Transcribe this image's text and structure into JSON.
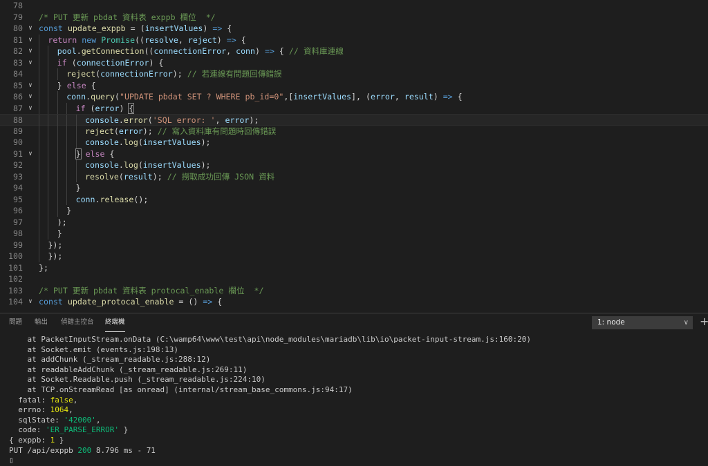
{
  "editor": {
    "lines": [
      {
        "n": "78",
        "fold": false,
        "indent": 0,
        "tokens": []
      },
      {
        "n": "79",
        "fold": false,
        "indent": 0,
        "tokens": [
          [
            "/* PUT 更新 pbdat 資料表 exppb 欄位  */",
            "com"
          ]
        ]
      },
      {
        "n": "80",
        "fold": true,
        "indent": 0,
        "tokens": [
          [
            "const",
            "kw"
          ],
          [
            " ",
            "pun"
          ],
          [
            "update_exppb",
            "fn"
          ],
          [
            " = (",
            "pun"
          ],
          [
            "insertValues",
            "var"
          ],
          [
            ") ",
            "pun"
          ],
          [
            "=>",
            "kw"
          ],
          [
            " {",
            "pun"
          ]
        ]
      },
      {
        "n": "81",
        "fold": true,
        "indent": 1,
        "tokens": [
          [
            "return",
            "ctl"
          ],
          [
            " ",
            "pun"
          ],
          [
            "new",
            "kw"
          ],
          [
            " ",
            "pun"
          ],
          [
            "Promise",
            "cls"
          ],
          [
            "((",
            "pun"
          ],
          [
            "resolve",
            "var"
          ],
          [
            ", ",
            "pun"
          ],
          [
            "reject",
            "var"
          ],
          [
            ") ",
            "pun"
          ],
          [
            "=>",
            "kw"
          ],
          [
            " {",
            "pun"
          ]
        ]
      },
      {
        "n": "82",
        "fold": true,
        "indent": 2,
        "tokens": [
          [
            "pool",
            "var"
          ],
          [
            ".",
            "pun"
          ],
          [
            "getConnection",
            "fn"
          ],
          [
            "((",
            "pun"
          ],
          [
            "connectionError",
            "var"
          ],
          [
            ", ",
            "pun"
          ],
          [
            "conn",
            "var"
          ],
          [
            ") ",
            "pun"
          ],
          [
            "=>",
            "kw"
          ],
          [
            " { ",
            "pun"
          ],
          [
            "// 資料庫連線",
            "com"
          ]
        ]
      },
      {
        "n": "83",
        "fold": true,
        "indent": 2,
        "tokens": [
          [
            "if",
            "ctl"
          ],
          [
            " (",
            "pun"
          ],
          [
            "connectionError",
            "var"
          ],
          [
            ") {",
            "pun"
          ]
        ]
      },
      {
        "n": "84",
        "fold": false,
        "indent": 3,
        "tokens": [
          [
            "reject",
            "fn"
          ],
          [
            "(",
            "pun"
          ],
          [
            "connectionError",
            "var"
          ],
          [
            "); ",
            "pun"
          ],
          [
            "// 若連線有問題回傳錯誤",
            "com"
          ]
        ]
      },
      {
        "n": "85",
        "fold": true,
        "indent": 2,
        "tokens": [
          [
            "} ",
            "pun"
          ],
          [
            "else",
            "ctl"
          ],
          [
            " {",
            "pun"
          ]
        ]
      },
      {
        "n": "86",
        "fold": true,
        "indent": 3,
        "tokens": [
          [
            "conn",
            "var"
          ],
          [
            ".",
            "pun"
          ],
          [
            "query",
            "fn"
          ],
          [
            "(",
            "pun"
          ],
          [
            "\"UPDATE pbdat SET ? WHERE pb_id=0\"",
            "str"
          ],
          [
            ",[",
            "pun"
          ],
          [
            "insertValues",
            "var"
          ],
          [
            "], (",
            "pun"
          ],
          [
            "error",
            "var"
          ],
          [
            ", ",
            "pun"
          ],
          [
            "result",
            "var"
          ],
          [
            ") ",
            "pun"
          ],
          [
            "=>",
            "kw"
          ],
          [
            " {",
            "pun"
          ]
        ]
      },
      {
        "n": "87",
        "fold": true,
        "indent": 4,
        "tokens": [
          [
            "if",
            "ctl"
          ],
          [
            " (",
            "pun"
          ],
          [
            "error",
            "var"
          ],
          [
            ") ",
            "pun"
          ],
          [
            "{",
            "box"
          ]
        ]
      },
      {
        "n": "88",
        "fold": false,
        "indent": 5,
        "current": true,
        "tokens": [
          [
            "console",
            "var"
          ],
          [
            ".",
            "pun"
          ],
          [
            "error",
            "fn"
          ],
          [
            "(",
            "pun"
          ],
          [
            "'SQL error: '",
            "str"
          ],
          [
            ", ",
            "pun"
          ],
          [
            "error",
            "var"
          ],
          [
            ");",
            "pun"
          ]
        ]
      },
      {
        "n": "89",
        "fold": false,
        "indent": 5,
        "tokens": [
          [
            "reject",
            "fn"
          ],
          [
            "(",
            "pun"
          ],
          [
            "error",
            "var"
          ],
          [
            "); ",
            "pun"
          ],
          [
            "// 寫入資料庫有問題時回傳錯誤",
            "com"
          ]
        ]
      },
      {
        "n": "90",
        "fold": false,
        "indent": 5,
        "tokens": [
          [
            "console",
            "var"
          ],
          [
            ".",
            "pun"
          ],
          [
            "log",
            "fn"
          ],
          [
            "(",
            "pun"
          ],
          [
            "insertValues",
            "var"
          ],
          [
            ");",
            "pun"
          ]
        ]
      },
      {
        "n": "91",
        "fold": true,
        "indent": 4,
        "tokens": [
          [
            "}",
            "box"
          ],
          [
            " ",
            "pun"
          ],
          [
            "else",
            "ctl"
          ],
          [
            " {",
            "pun"
          ]
        ]
      },
      {
        "n": "92",
        "fold": false,
        "indent": 5,
        "tokens": [
          [
            "console",
            "var"
          ],
          [
            ".",
            "pun"
          ],
          [
            "log",
            "fn"
          ],
          [
            "(",
            "pun"
          ],
          [
            "insertValues",
            "var"
          ],
          [
            ");",
            "pun"
          ]
        ]
      },
      {
        "n": "93",
        "fold": false,
        "indent": 5,
        "tokens": [
          [
            "resolve",
            "fn"
          ],
          [
            "(",
            "pun"
          ],
          [
            "result",
            "var"
          ],
          [
            "); ",
            "pun"
          ],
          [
            "// 撈取成功回傳 JSON 資料",
            "com"
          ]
        ]
      },
      {
        "n": "94",
        "fold": false,
        "indent": 4,
        "tokens": [
          [
            "}",
            "pun"
          ]
        ]
      },
      {
        "n": "95",
        "fold": false,
        "indent": 4,
        "tokens": [
          [
            "conn",
            "var"
          ],
          [
            ".",
            "pun"
          ],
          [
            "release",
            "fn"
          ],
          [
            "();",
            "pun"
          ]
        ]
      },
      {
        "n": "96",
        "fold": false,
        "indent": 3,
        "tokens": [
          [
            "}",
            "pun"
          ]
        ]
      },
      {
        "n": "97",
        "fold": false,
        "indent": 2,
        "tokens": [
          [
            ");",
            "pun"
          ]
        ]
      },
      {
        "n": "98",
        "fold": false,
        "indent": 2,
        "tokens": [
          [
            "}",
            "pun"
          ]
        ]
      },
      {
        "n": "99",
        "fold": false,
        "indent": 1,
        "tokens": [
          [
            "});",
            "pun"
          ]
        ]
      },
      {
        "n": "100",
        "fold": false,
        "indent": 1,
        "tokens": [
          [
            "});",
            "pun"
          ]
        ]
      },
      {
        "n": "101",
        "fold": false,
        "indent": 0,
        "tokens": [
          [
            "};",
            "pun"
          ]
        ]
      },
      {
        "n": "102",
        "fold": false,
        "indent": 0,
        "tokens": []
      },
      {
        "n": "103",
        "fold": false,
        "indent": 0,
        "tokens": [
          [
            "/* PUT 更新 pbdat 資料表 protocal_enable 欄位  */",
            "com"
          ]
        ]
      },
      {
        "n": "104",
        "fold": true,
        "indent": 0,
        "tokens": [
          [
            "const",
            "kw"
          ],
          [
            " ",
            "pun"
          ],
          [
            "update_protocal_enable",
            "fn"
          ],
          [
            " = () ",
            "pun"
          ],
          [
            "=>",
            "kw"
          ],
          [
            " {",
            "pun"
          ]
        ]
      }
    ]
  },
  "panel": {
    "tabs": [
      {
        "label": "問題",
        "active": false
      },
      {
        "label": "輸出",
        "active": false
      },
      {
        "label": "偵錯主控台",
        "active": false
      },
      {
        "label": "終端機",
        "active": true
      }
    ],
    "terminal_select": "1: node",
    "terminal_lines": [
      [
        [
          "    at PacketInputStream.onData (C:\\wamp64\\www\\test\\api\\node_modules\\mariadb\\lib\\io\\packet-input-stream.js:160:20)",
          ""
        ]
      ],
      [
        [
          "    at Socket.emit (events.js:198:13)",
          ""
        ]
      ],
      [
        [
          "    at addChunk (_stream_readable.js:288:12)",
          ""
        ]
      ],
      [
        [
          "    at readableAddChunk (_stream_readable.js:269:11)",
          ""
        ]
      ],
      [
        [
          "    at Socket.Readable.push (_stream_readable.js:224:10)",
          ""
        ]
      ],
      [
        [
          "    at TCP.onStreamRead [as onread] (internal/stream_base_commons.js:94:17)",
          ""
        ]
      ],
      [
        [
          "  fatal: ",
          ""
        ],
        [
          "false",
          "yel"
        ],
        [
          ",",
          ""
        ]
      ],
      [
        [
          "  errno: ",
          ""
        ],
        [
          "1064",
          "yel"
        ],
        [
          ",",
          ""
        ]
      ],
      [
        [
          "  sqlState: ",
          ""
        ],
        [
          "'42000'",
          "grn"
        ],
        [
          ",",
          ""
        ]
      ],
      [
        [
          "  code: ",
          ""
        ],
        [
          "'ER_PARSE_ERROR'",
          "grn"
        ],
        [
          " }",
          ""
        ]
      ],
      [
        [
          "{ exppb: ",
          ""
        ],
        [
          "1",
          "yel"
        ],
        [
          " }",
          ""
        ]
      ],
      [
        [
          "PUT /api/exppb ",
          ""
        ],
        [
          "200",
          "grn"
        ],
        [
          " 8.796 ms - 71",
          ""
        ]
      ],
      [
        [
          "▯",
          "cursor"
        ]
      ]
    ]
  }
}
